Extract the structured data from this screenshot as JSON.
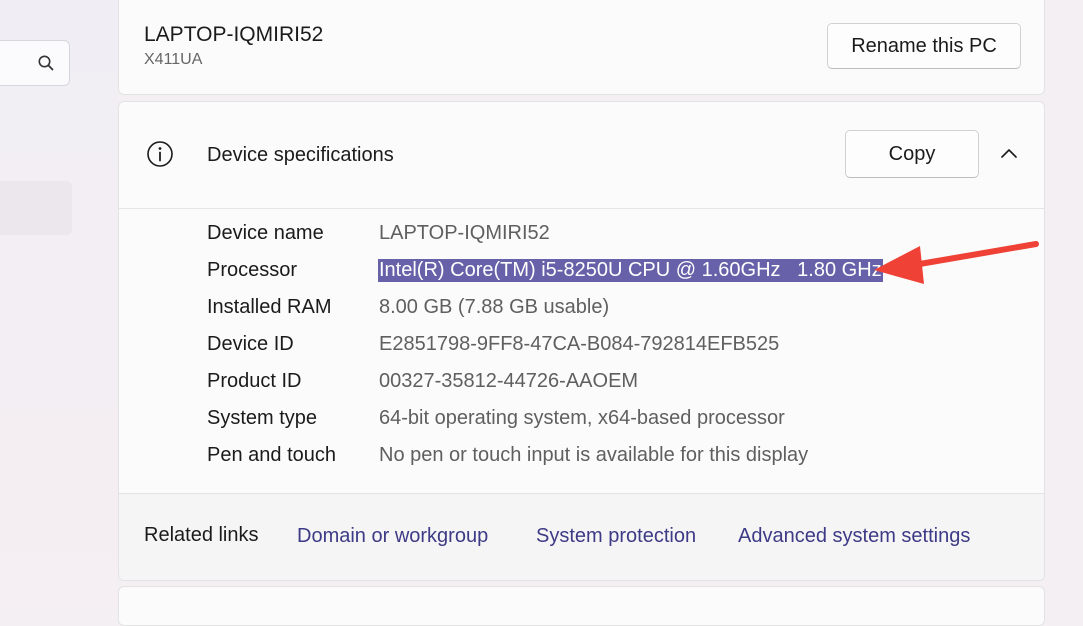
{
  "search": {
    "icon": "search-icon"
  },
  "pc": {
    "name": "LAPTOP-IQMIRI52",
    "model": "X411UA",
    "rename_label": "Rename this PC"
  },
  "specs": {
    "title": "Device specifications",
    "copy_label": "Copy",
    "rows": [
      {
        "label": "Device name",
        "value": "LAPTOP-IQMIRI52"
      },
      {
        "label": "Processor",
        "value": "Intel(R) Core(TM) i5-8250U CPU @ 1.60GHz   1.80 GHz"
      },
      {
        "label": "Installed RAM",
        "value": "8.00 GB (7.88 GB usable)"
      },
      {
        "label": "Device ID",
        "value": "E2851798-9FF8-47CA-B084-792814EFB525"
      },
      {
        "label": "Product ID",
        "value": "00327-35812-44726-AAOEM"
      },
      {
        "label": "System type",
        "value": "64-bit operating system, x64-based processor"
      },
      {
        "label": "Pen and touch",
        "value": "No pen or touch input is available for this display"
      }
    ]
  },
  "related": {
    "title": "Related links",
    "links": [
      "Domain or workgroup",
      "System protection",
      "Advanced system settings"
    ]
  },
  "colors": {
    "highlight": "#6661a8",
    "link": "#3d3a86",
    "arrow": "#ef4135"
  }
}
